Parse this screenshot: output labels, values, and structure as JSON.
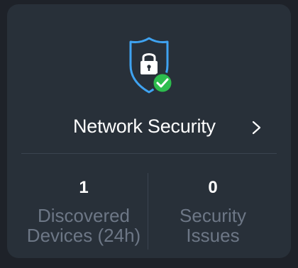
{
  "card": {
    "title": "Network Security",
    "icon": "shield-lock-check-icon",
    "chevron_icon": "chevron-right-icon",
    "stats": [
      {
        "value": "1",
        "label_line1": "Discovered",
        "label_line2": "Devices (24h)"
      },
      {
        "value": "0",
        "label_line1": "Security",
        "label_line2": "Issues"
      }
    ]
  },
  "colors": {
    "background": "#1e2229",
    "card": "#283039",
    "shield_outline": "#3fa3f1",
    "check_badge": "#2dbd4e",
    "label_text": "#6d7786"
  }
}
